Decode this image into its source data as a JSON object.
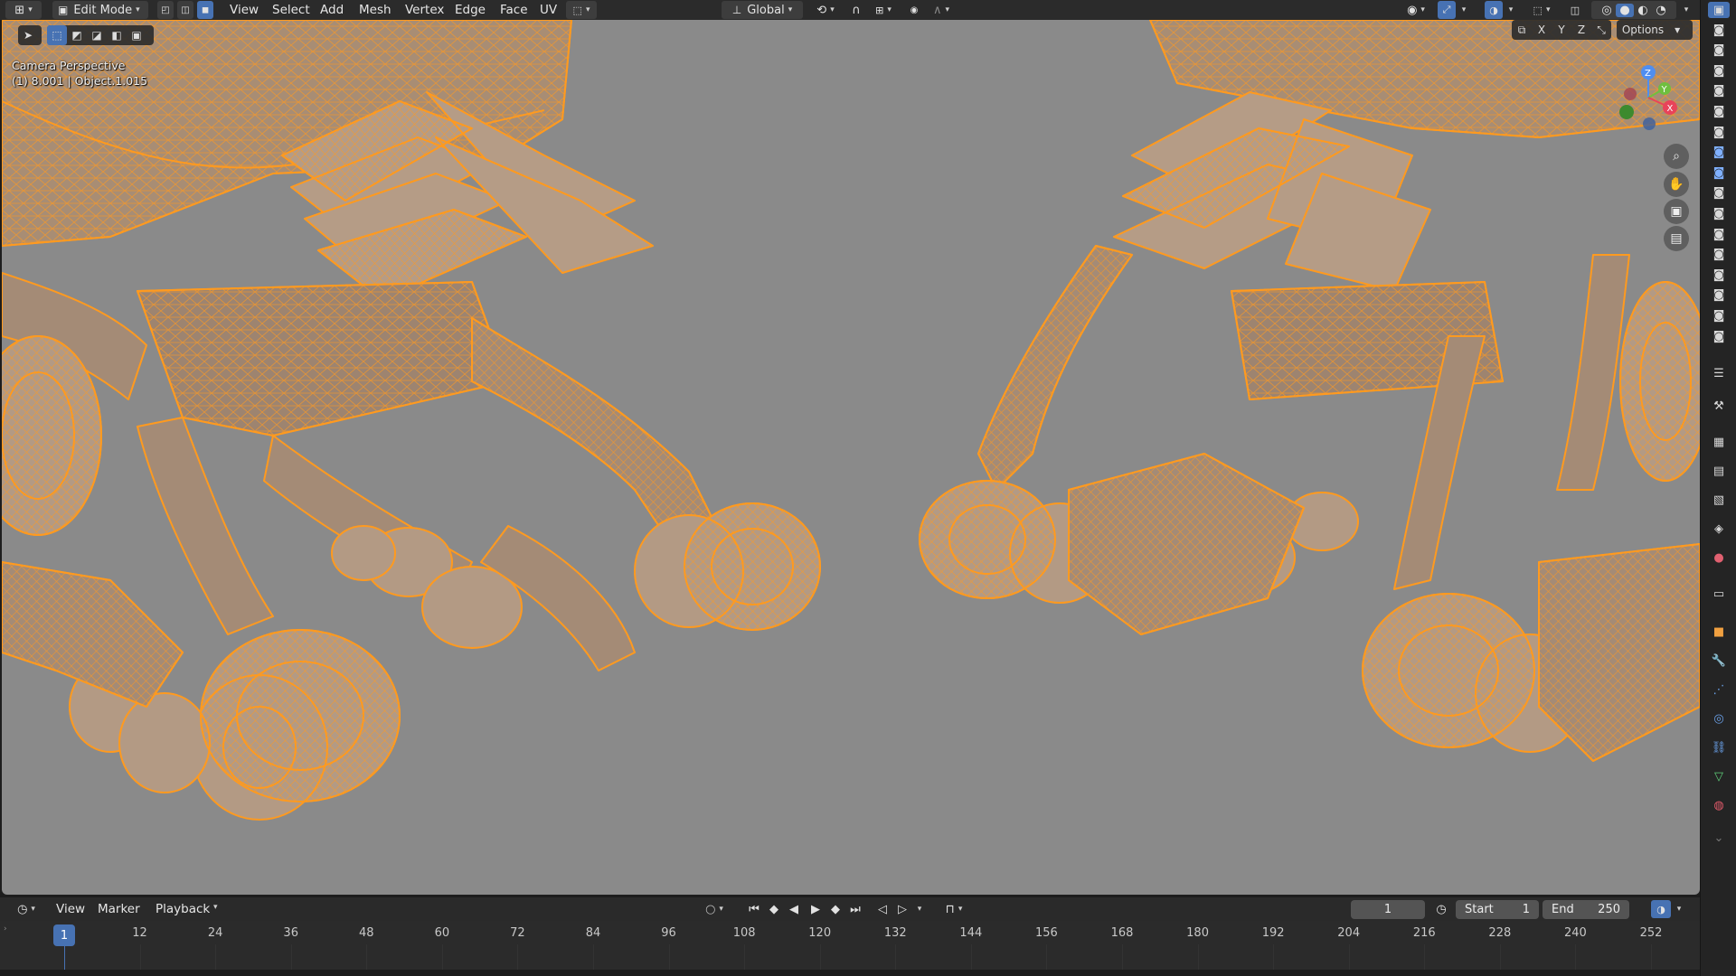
{
  "header": {
    "mode": "Edit Mode",
    "menus": [
      "View",
      "Select",
      "Add",
      "Mesh",
      "Vertex",
      "Edge",
      "Face",
      "UV"
    ],
    "transform_orientation": "Global",
    "options_label": "Options",
    "axis_labels": [
      "X",
      "Y",
      "Z"
    ]
  },
  "viewport": {
    "overlay_line1": "Camera Perspective",
    "overlay_line2": "(1) 8.001 | Object.1.015",
    "gizmo_axes": [
      "Z",
      "Y",
      "X"
    ],
    "colors": {
      "background": "#8a8a8a",
      "mesh_edge": "#ff9a1f",
      "mesh_fill": "#a88d74"
    }
  },
  "timeline": {
    "menus": [
      "View",
      "Marker",
      "Playback"
    ],
    "current_frame": "1",
    "start_label": "Start",
    "start_value": "1",
    "end_label": "End",
    "end_value": "250",
    "ticks": [
      "12",
      "24",
      "36",
      "48",
      "60",
      "72",
      "84",
      "96",
      "108",
      "120",
      "132",
      "144",
      "156",
      "168",
      "180",
      "192",
      "204",
      "216",
      "228",
      "240",
      "252"
    ],
    "playhead_label": "1"
  },
  "icons": {
    "right_strip": [
      "outliner-camera-icon",
      "tool-icon",
      "render-icon",
      "output-icon",
      "view-layer-icon",
      "scene-icon",
      "world-icon",
      "collection-icon",
      "object-icon",
      "modifier-icon",
      "particles-icon",
      "physics-icon",
      "constraints-icon",
      "data-icon",
      "material-icon"
    ]
  }
}
